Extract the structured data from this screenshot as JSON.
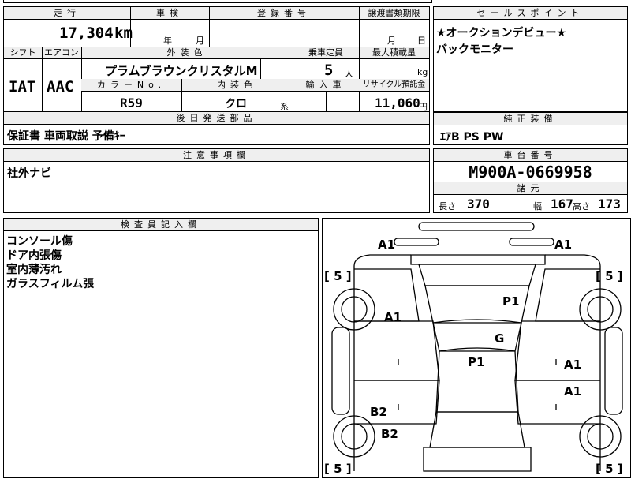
{
  "headers": {
    "mileage": "走行",
    "inspection": "車検",
    "registration": "登録番号",
    "transfer_deadline": "譲渡書類期限",
    "sales_point": "セールスポイント",
    "shift": "シフト",
    "aircon": "エアコン",
    "exterior_color": "外装色",
    "capacity": "乗車定員",
    "max_load": "最大積載量",
    "color_no": "カラーNo.",
    "interior_color": "内装色",
    "import": "輸入車",
    "recycle": "リサイクル預託金",
    "rear_parts": "後日発送部品",
    "genuine_equipment": "純正装備",
    "notes": "注意事項欄",
    "chassis_no": "車台番号",
    "specs": "諸元",
    "inspector_notes": "検査員記入欄"
  },
  "values": {
    "mileage": "17,304",
    "mileage_unit": "km",
    "inspection_year": "年",
    "inspection_month": "月",
    "transfer_month": "月",
    "transfer_day": "日",
    "shift": "IAT",
    "aircon": "AAC",
    "exterior_color": "プラムブラウンクリスタルM",
    "capacity": "5",
    "capacity_unit": "人",
    "max_load_unit": "kg",
    "color_no": "R59",
    "interior_color": "クロ",
    "interior_suffix": "系",
    "recycle": "11,060",
    "recycle_unit": "円",
    "rear_parts": "保証書 車両取説 予備ｷｰ",
    "genuine_equipment": "ｴｱB PS PW",
    "notes": "社外ナビ",
    "chassis_no": "M900A-0669958",
    "length_label": "長さ",
    "length": "370",
    "width_label": "幅",
    "width": "167",
    "height_label": "高さ",
    "height": "173"
  },
  "sales_points": [
    "★オークションデビュー★",
    "バックモニター"
  ],
  "inspector_notes": [
    "コンソール傷",
    "ドア内張傷",
    "室内薄汚れ",
    "ガラスフィルム張"
  ],
  "diagram_marks": [
    {
      "id": "a1-top-left",
      "text": "A1"
    },
    {
      "id": "a1-top-right",
      "text": "A1"
    },
    {
      "id": "p1-roof",
      "text": "P1"
    },
    {
      "id": "a1-left",
      "text": "A1"
    },
    {
      "id": "g-windshield",
      "text": "G"
    },
    {
      "id": "p1-hood",
      "text": "P1"
    },
    {
      "id": "a1-right-1",
      "text": "A1"
    },
    {
      "id": "a1-right-2",
      "text": "A1"
    },
    {
      "id": "b2-left-1",
      "text": "B2"
    },
    {
      "id": "b2-left-2",
      "text": "B2"
    }
  ],
  "tire_marks": [
    {
      "id": "tire-rear-left",
      "text": "[ 5 ]"
    },
    {
      "id": "tire-rear-right",
      "text": "[ 5 ]"
    },
    {
      "id": "tire-front-left",
      "text": "[ 5 ]"
    },
    {
      "id": "tire-front-right",
      "text": "[ 5 ]"
    }
  ]
}
